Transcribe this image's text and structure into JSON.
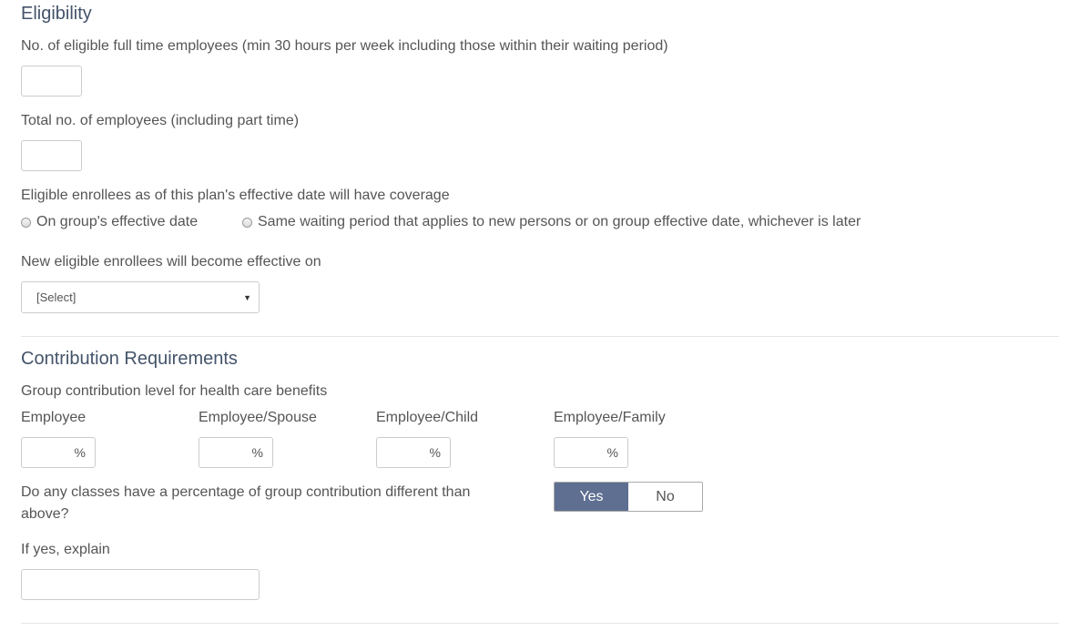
{
  "eligibility": {
    "heading": "Eligibility",
    "full_time_label": "No. of eligible full time employees (min 30 hours per week including those within their waiting period)",
    "full_time_value": "",
    "total_label": "Total no. of employees (including part time)",
    "total_value": "",
    "coverage_label": "Eligible enrollees as of this plan's effective date will have coverage",
    "coverage_options": [
      "On group's effective date",
      "Same waiting period that applies to new persons or on group effective date, whichever is later"
    ],
    "new_enrollees_label": "New eligible enrollees will become effective on",
    "new_enrollees_selected": "[Select]"
  },
  "contribution": {
    "heading": "Contribution Requirements",
    "group_label": "Group contribution level for health care benefits",
    "columns": [
      {
        "label": "Employee",
        "value": "",
        "suffix": "%"
      },
      {
        "label": "Employee/Spouse",
        "value": "",
        "suffix": "%"
      },
      {
        "label": "Employee/Child",
        "value": "",
        "suffix": "%"
      },
      {
        "label": "Employee/Family",
        "value": "",
        "suffix": "%"
      }
    ],
    "classes_question_line1": "Do any classes have a percentage of group contribution different than",
    "classes_question_line2": "above?",
    "toggle": {
      "yes": "Yes",
      "no": "No",
      "selected": "Yes"
    },
    "explain_label": "If yes, explain",
    "explain_value": ""
  },
  "colors": {
    "heading": "#44546a",
    "toggle_active": "#5e6f91",
    "text": "#555555",
    "border": "#cccccc"
  }
}
